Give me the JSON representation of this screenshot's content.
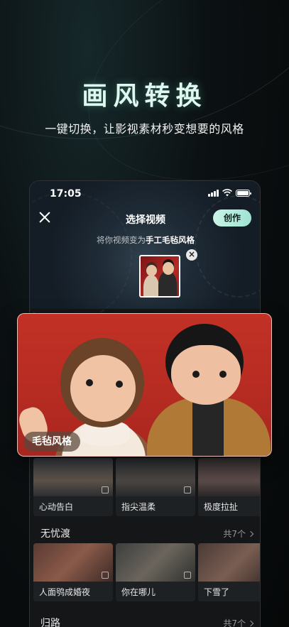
{
  "promo": {
    "title": "画风转换",
    "subtitle": "一键切换，让影视素材秒变想要的风格"
  },
  "phone": {
    "time": "17:05",
    "title": "选择视频",
    "create_label": "创作",
    "hint_prefix": "将你视频变为",
    "hint_style": "手工毛毡风格",
    "delete_symbol": "×"
  },
  "preview": {
    "style_tag": "毛毡风格"
  },
  "row1": {
    "items": [
      {
        "label": "心动告白"
      },
      {
        "label": "指尖温柔"
      },
      {
        "label": "极度拉扯"
      }
    ]
  },
  "section2": {
    "title": "无忧渡",
    "count": "共7个",
    "items": [
      {
        "label": "人面鸮成婚夜"
      },
      {
        "label": "你在哪儿"
      },
      {
        "label": "下雪了"
      }
    ]
  },
  "section3": {
    "title": "归路",
    "count": "共7个"
  },
  "colors": {
    "accent": "#9fe3d3",
    "felt_red": "#c23125",
    "panel": "#141618"
  }
}
